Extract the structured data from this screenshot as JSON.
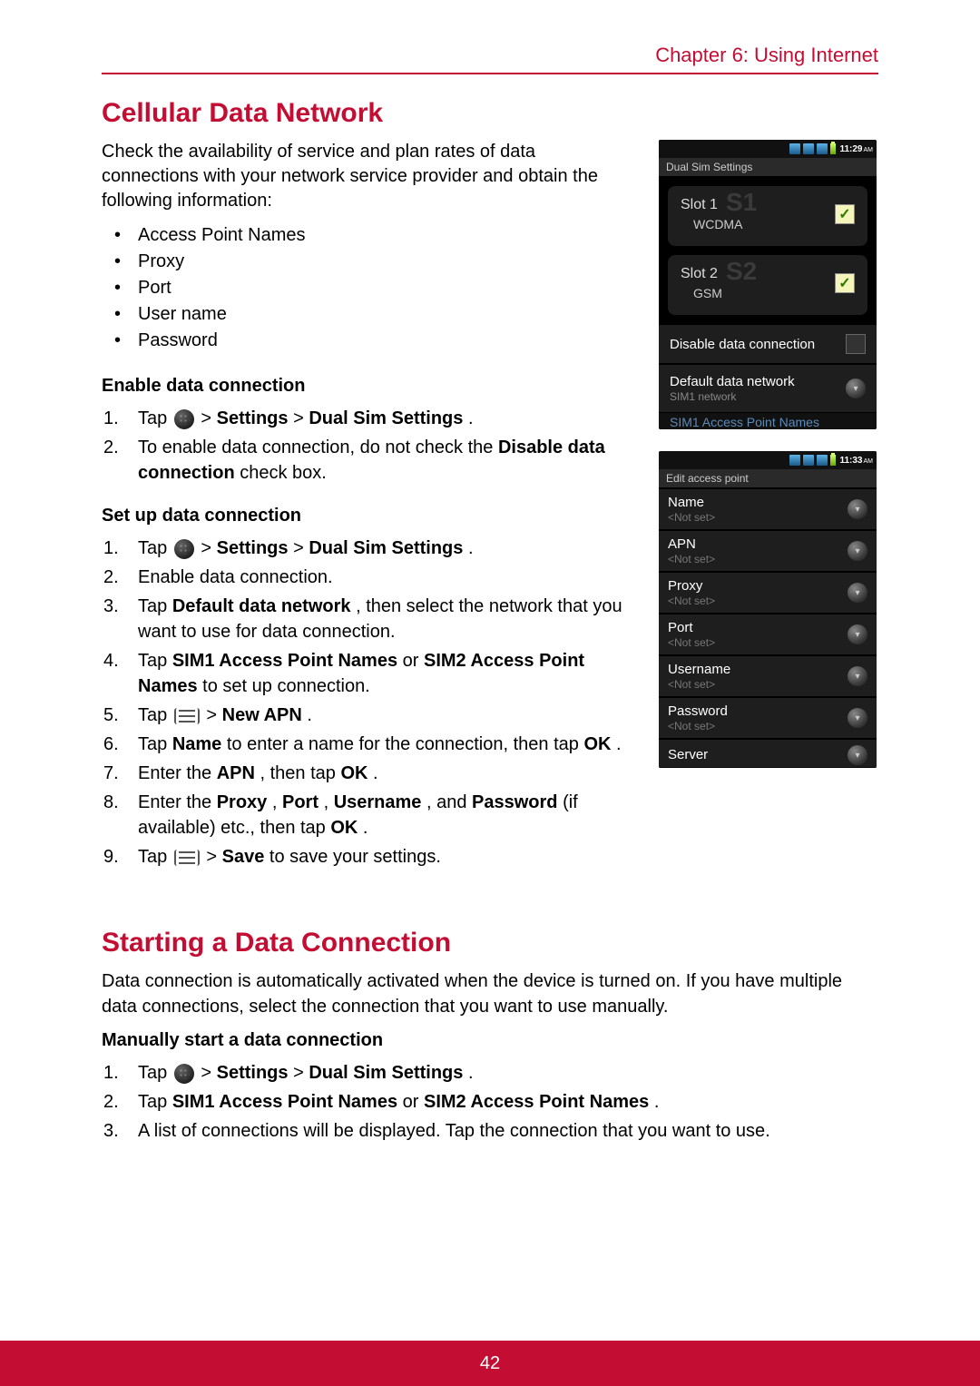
{
  "chapter": "Chapter 6: Using Internet",
  "page_number": "42",
  "sec1": {
    "title": "Cellular Data Network",
    "intro": "Check the availability of service and plan rates of data connections with your network service provider and obtain the following information:",
    "bullets": [
      "Access Point Names",
      "Proxy",
      "Port",
      "User name",
      "Password"
    ],
    "enable_head": "Enable data connection",
    "enable_steps": {
      "s1_pre": "Tap ",
      "s1_mid": "  > ",
      "s1_b1": "Settings",
      "s1_sep": " > ",
      "s1_b2": "Dual Sim Settings",
      "s1_post": ".",
      "s2_pre": "To enable data connection, do not check the ",
      "s2_b": "Disable data connection",
      "s2_post": " check box."
    },
    "setup_head": "Set up data connection",
    "setup": {
      "s1_pre": "Tap ",
      "s1_mid": "  > ",
      "s1_b1": "Settings",
      "s1_sep": " > ",
      "s1_b2": "Dual Sim Settings",
      "s1_post": ".",
      "s2": "Enable data connection.",
      "s3_pre": "Tap ",
      "s3_b": "Default data network",
      "s3_post": ", then select the network that you want to use for data connection.",
      "s4_pre": "Tap ",
      "s4_b1": "SIM1 Access Point Names",
      "s4_or": " or ",
      "s4_b2": "SIM2 Access Point Names",
      "s4_post": " to set up connection.",
      "s5_pre": "Tap ",
      "s5_mid": " > ",
      "s5_b": "New APN",
      "s5_post": ".",
      "s6_pre": "Tap ",
      "s6_b1": "Name",
      "s6_mid": " to enter a name for the connection, then tap ",
      "s6_b2": "OK",
      "s6_post": ".",
      "s7_pre": "Enter the ",
      "s7_b1": "APN",
      "s7_mid": ", then tap ",
      "s7_b2": "OK",
      "s7_post": ".",
      "s8_pre": "Enter the ",
      "s8_b1": "Proxy",
      "s8_c1": ", ",
      "s8_b2": "Port",
      "s8_c2": ", ",
      "s8_b3": "Username",
      "s8_c3": ", and ",
      "s8_b4": "Password",
      "s8_mid": " (if available) etc., then tap ",
      "s8_b5": "OK",
      "s8_post": ".",
      "s9_pre": "Tap ",
      "s9_mid": " > ",
      "s9_b": "Save",
      "s9_post": " to save your settings."
    }
  },
  "sec2": {
    "title": "Starting a Data Connection",
    "intro": "Data connection is automatically activated when the device is turned on. If you have multiple data connections, select the connection that you want to use manually.",
    "head": "Manually start a data connection",
    "s1_pre": "Tap ",
    "s1_mid": "  > ",
    "s1_b1": "Settings",
    "s1_sep": " > ",
    "s1_b2": "Dual Sim Settings",
    "s1_post": ".",
    "s2_pre": "Tap ",
    "s2_b1": "SIM1 Access Point Names",
    "s2_or": " or ",
    "s2_b2": "SIM2 Access Point Names",
    "s2_post": ".",
    "s3": "A list of connections will be displayed. Tap the connection that you want to use."
  },
  "shot1": {
    "time": "11:29",
    "ampm": "AM",
    "title": "Dual Sim Settings",
    "slot1": "Slot 1",
    "slot1type": "WCDMA",
    "slot1num": "S1",
    "slot2": "Slot 2",
    "slot2type": "GSM",
    "slot2num": "S2",
    "disable": "Disable data connection",
    "defnet": "Default data network",
    "defnet_sub": "SIM1 network",
    "cutoff": "SIM1 Access Point Names"
  },
  "shot2": {
    "time": "11:33",
    "ampm": "AM",
    "title": "Edit access point",
    "notset": "<Not set>",
    "items": [
      "Name",
      "APN",
      "Proxy",
      "Port",
      "Username",
      "Password",
      "Server"
    ]
  }
}
